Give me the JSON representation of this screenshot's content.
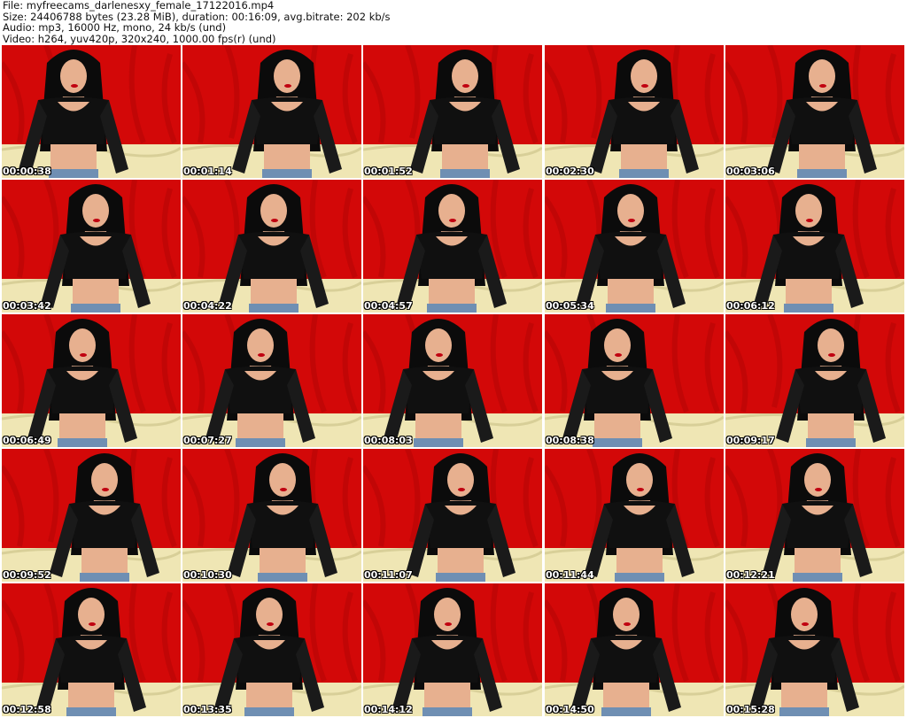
{
  "header": {
    "file": "File: myfreecams_darlenesxy_female_17122016.mp4",
    "size": "Size: 24406788 bytes (23.28 MiB), duration: 00:16:09, avg.bitrate: 202 kb/s",
    "audio": "Audio: mp3, 16000 Hz, mono, 24 kb/s (und)",
    "video": "Video: h264, yuv420p, 320x240, 1000.00 fps(r) (und)"
  },
  "thumbnails": [
    "00:00:38",
    "00:01:14",
    "00:01:52",
    "00:02:30",
    "00:03:06",
    "00:03:42",
    "00:04:22",
    "00:04:57",
    "00:05:34",
    "00:06:12",
    "00:06:49",
    "00:07:27",
    "00:08:03",
    "00:08:38",
    "00:09:17",
    "00:09:52",
    "00:10:30",
    "00:11:07",
    "00:11:44",
    "00:12:21",
    "00:12:58",
    "00:13:35",
    "00:14:12",
    "00:14:50",
    "00:15:28"
  ],
  "colors": {
    "background_curtain": "#d30808",
    "floor": "#efe6b4",
    "top": "#101010",
    "hair": "#0b0b0b",
    "skin": "#e7b08f"
  }
}
